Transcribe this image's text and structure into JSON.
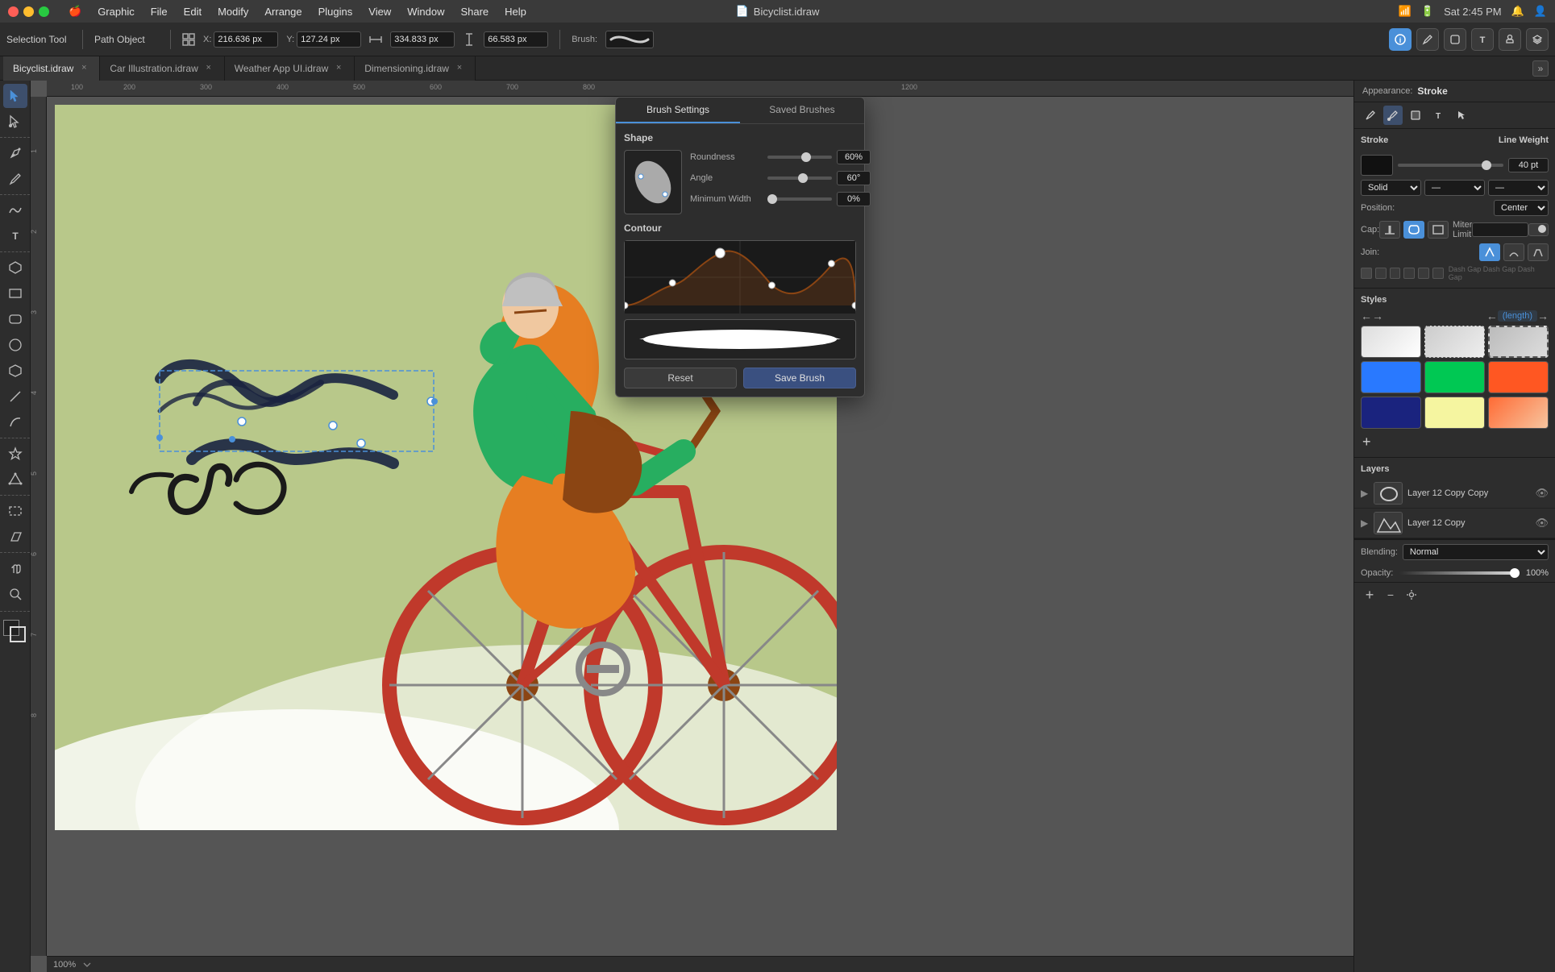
{
  "window": {
    "title": "Bicyclist.idraw",
    "icon": "📄"
  },
  "menubar": {
    "apple": "🍎",
    "items": [
      "Graphic",
      "File",
      "Edit",
      "Modify",
      "Arrange",
      "Plugins",
      "View",
      "Window",
      "Share",
      "Help"
    ]
  },
  "titlebar_right": {
    "time": "Sat 2:45 PM",
    "wifi": "wifi",
    "battery": "battery"
  },
  "toolbar": {
    "tool_label": "Selection Tool",
    "object_label": "Path Object",
    "x_label": "X:",
    "x_value": "216.636 px",
    "y_label": "Y:",
    "y_value": "127.24 px",
    "w_label": "W:",
    "w_value": "334.833 px",
    "h_label": "H:",
    "h_value": "66.583 px",
    "brush_label": "Brush:"
  },
  "tabs": [
    {
      "id": "tab1",
      "label": "Bicyclist.idraw",
      "active": true
    },
    {
      "id": "tab2",
      "label": "Car Illustration.idraw",
      "active": false
    },
    {
      "id": "tab3",
      "label": "Weather App UI.idraw",
      "active": false
    },
    {
      "id": "tab4",
      "label": "Dimensioning.idraw",
      "active": false
    }
  ],
  "canvas": {
    "zoom": "100%",
    "background_color": "#b8c88a"
  },
  "brush_popup": {
    "tabs": [
      "Brush Settings",
      "Saved Brushes"
    ],
    "active_tab": "Brush Settings",
    "shape_section": "Shape",
    "roundness_label": "Roundness",
    "roundness_value": "60%",
    "roundness_percent": 60,
    "angle_label": "Angle",
    "angle_value": "60°",
    "angle_percent": 55,
    "min_width_label": "Minimum Width",
    "min_width_value": "0%",
    "min_width_percent": 0,
    "contour_label": "Contour",
    "reset_btn": "Reset",
    "save_btn": "Save Brush"
  },
  "right_panel": {
    "appearance_label": "Appearance:",
    "appearance_type": "Stroke",
    "stroke_section": "Stroke",
    "line_weight_label": "Line Weight",
    "line_weight_value": "40 pt",
    "position_label": "Position:",
    "position_value": "Center",
    "cap_label": "Cap:",
    "join_label": "Join:",
    "miter_label": "Miter Limit",
    "styles_label": "Styles",
    "arrow_left": "←",
    "arrow_right": "→",
    "arrow_left2": "←",
    "arrow_right2": "→",
    "length_label": "(length)",
    "layers_label": "Layers",
    "layers": [
      {
        "name": "Layer 12 Copy Copy",
        "visible": true
      },
      {
        "name": "Layer 12 Copy",
        "visible": true
      }
    ],
    "blending_label": "Blending:",
    "blending_value": "Normal",
    "opacity_label": "Opacity:",
    "opacity_value": "100%"
  },
  "icons": {
    "pen": "✏️",
    "pencil": "✏",
    "arrow": "↖",
    "curve_arrow": "↗",
    "node": "◆",
    "text": "T",
    "shape": "⬜",
    "circle": "⭕",
    "line": "╱",
    "star": "★",
    "freehand": "〜",
    "rectangle_frame": "▭",
    "parallelogram": "▱",
    "hand": "✋",
    "zoom": "🔍",
    "color_fill": "■",
    "color_stroke": "□",
    "search": "🔍",
    "grid": "⊞",
    "pen_tool": "🖊",
    "info": "ℹ",
    "gear": "⚙",
    "eye": "👁"
  }
}
